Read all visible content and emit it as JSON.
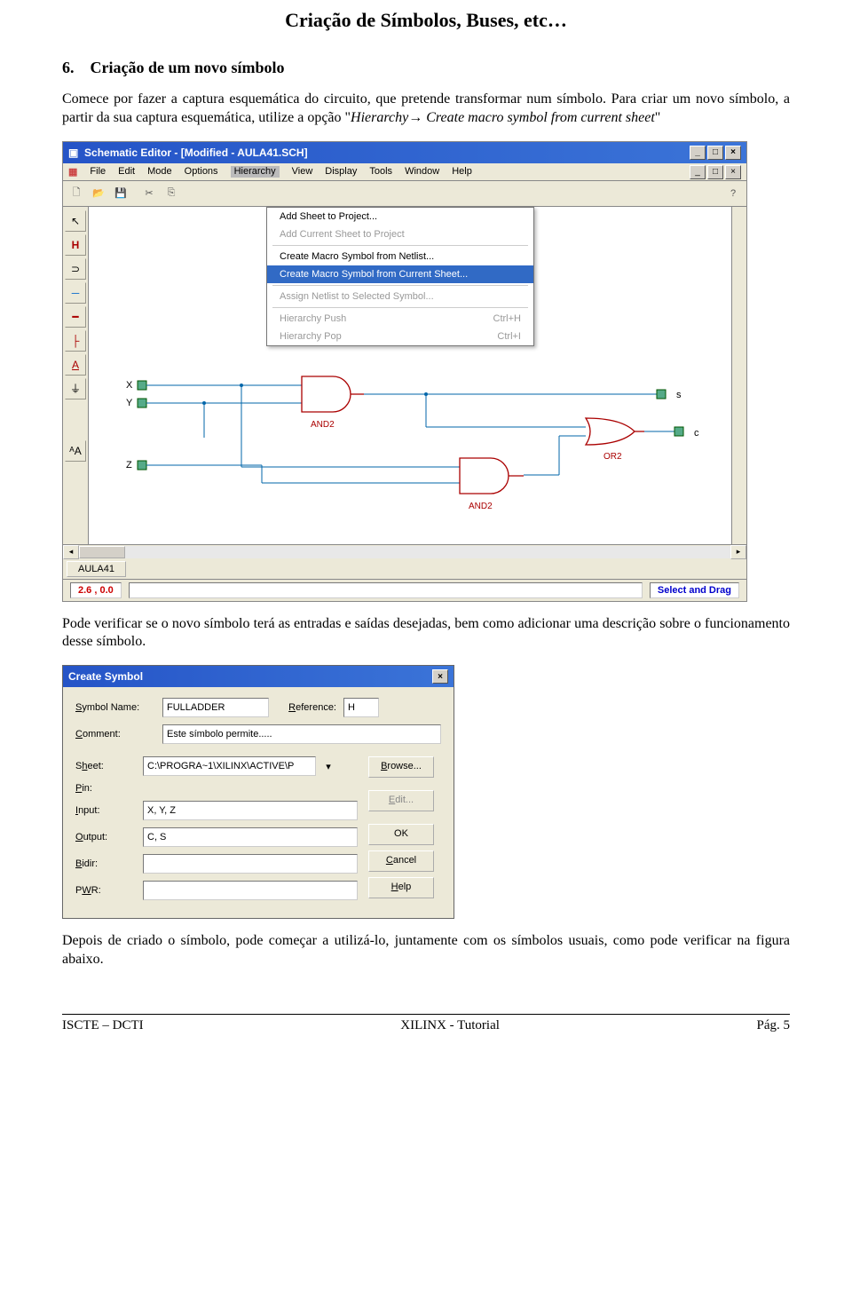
{
  "header": "Criação de Símbolos, Buses, etc…",
  "section": {
    "number": "6.",
    "title": "Criação de um novo símbolo"
  },
  "para1": "Comece por fazer a captura esquemática do circuito, que pretende transformar num símbolo. Para criar um novo símbolo, a partir da sua captura esquemática, utilize a opção \"",
  "para1_italic": "Hierarchy→ Create macro symbol from current sheet",
  "para1_end": "\"",
  "editor": {
    "title": "Schematic Editor - [Modified - AULA41.SCH]",
    "menus": [
      "File",
      "Edit",
      "Mode",
      "Options",
      "Hierarchy",
      "View",
      "Display",
      "Tools",
      "Window",
      "Help"
    ],
    "dropdown": [
      {
        "label": "Add Sheet to Project...",
        "disabled": false
      },
      {
        "label": "Add Current Sheet to Project",
        "disabled": true
      },
      {
        "sep": true
      },
      {
        "label": "Create Macro Symbol from Netlist...",
        "disabled": false
      },
      {
        "label": "Create Macro Symbol from Current Sheet...",
        "highlighted": true
      },
      {
        "sep": true
      },
      {
        "label": "Assign Netlist to Selected Symbol...",
        "disabled": true
      },
      {
        "sep": true
      },
      {
        "label": "Hierarchy Push",
        "shortcut": "Ctrl+H",
        "disabled": true
      },
      {
        "label": "Hierarchy Pop",
        "shortcut": "Ctrl+I",
        "disabled": true
      }
    ],
    "pins_left": [
      "X",
      "Y",
      "Z"
    ],
    "pins_right": [
      "s",
      "c"
    ],
    "gates": [
      "AND2",
      "AND2",
      "OR2"
    ],
    "sheet_tab": "AULA41",
    "coord": "2.6 ,   0.0",
    "mode": "Select and Drag"
  },
  "para2": "Pode verificar se o novo símbolo terá as entradas e saídas desejadas, bem como adicionar uma descrição sobre o funcionamento desse símbolo.",
  "dialog": {
    "title": "Create Symbol",
    "fields": {
      "symbol_name_label": "Symbol Name:",
      "symbol_name_value": "FULLADDER",
      "reference_label": "Reference:",
      "reference_value": "H",
      "comment_label": "Comment:",
      "comment_value": "Este símbolo permite.....",
      "sheet_label": "Sheet:",
      "sheet_value": "C:\\PROGRA~1\\XILINX\\ACTIVE\\P",
      "pin_label": "Pin:",
      "input_label": "Input:",
      "input_value": "X, Y, Z",
      "output_label": "Output:",
      "output_value": "C, S",
      "bidir_label": "Bidir:",
      "bidir_value": "",
      "pwr_label": "PWR:",
      "pwr_value": ""
    },
    "buttons": {
      "browse": "Browse...",
      "edit": "Edit...",
      "ok": "OK",
      "cancel": "Cancel",
      "help": "Help"
    }
  },
  "para3": "Depois de criado o símbolo, pode começar a utilizá-lo, juntamente com os símbolos usuais, como pode verificar na figura abaixo.",
  "footer": {
    "left": "ISCTE – DCTI",
    "center": "XILINX - Tutorial",
    "right": "Pág. 5"
  }
}
